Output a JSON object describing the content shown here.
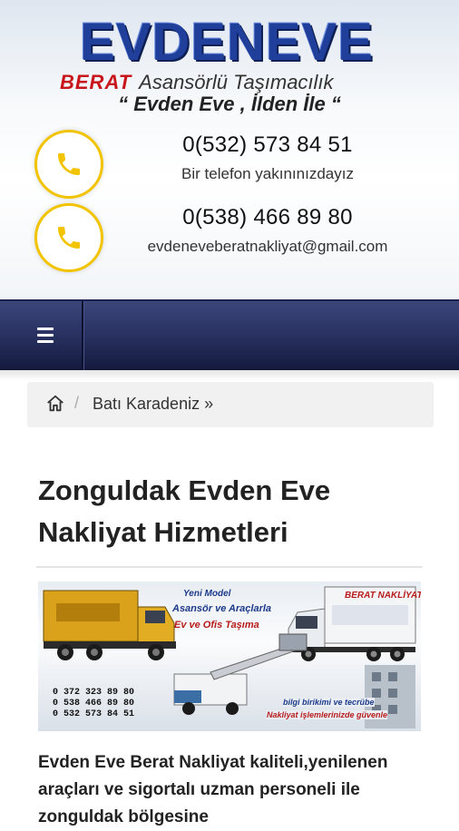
{
  "header": {
    "logo_main": "EVDENEVE",
    "logo_berat": "BERAT",
    "logo_tagline": "Asansörlü Taşımacılık",
    "logo_slogan": "“ Evden Eve , İlden İle “",
    "phone_1": "0(532) 573 84 51",
    "phone_1_sub": "Bir telefon yakınınızdayız",
    "phone_2": "0(538) 466 89 80",
    "email": "evdeneveberatnakliyat@gmail.com",
    "accent_color": "#f2c400"
  },
  "nav": {
    "menu_icon": "hamburger-menu-icon",
    "background": "#2a3363"
  },
  "breadcrumb": {
    "home_icon": "home-icon",
    "separator": "/",
    "item": "Batı Karadeniz »"
  },
  "article": {
    "title": "Zonguldak Evden Eve Nakliyat Hizmetleri",
    "banner": {
      "yeni_model": "Yeni Model",
      "asansor": "Asansör ve Araçlarla",
      "ev_ofis": "Ev ve Ofis Taşıma",
      "truck_name": "BERAT NAKLİYAT",
      "numbers": [
        "0 372 323 89 80",
        "0 538 466 89 80",
        "0 532 573 84 51"
      ],
      "bilgi": "bilgi birikimi ve tecrübe",
      "isim": "Nakliyat işlemlerinizde güvenle"
    },
    "intro": "Evden Eve Berat Nakliyat kaliteli,yenilenen araçları ve sigortalı uzman personeli ile zonguldak bölgesine"
  }
}
